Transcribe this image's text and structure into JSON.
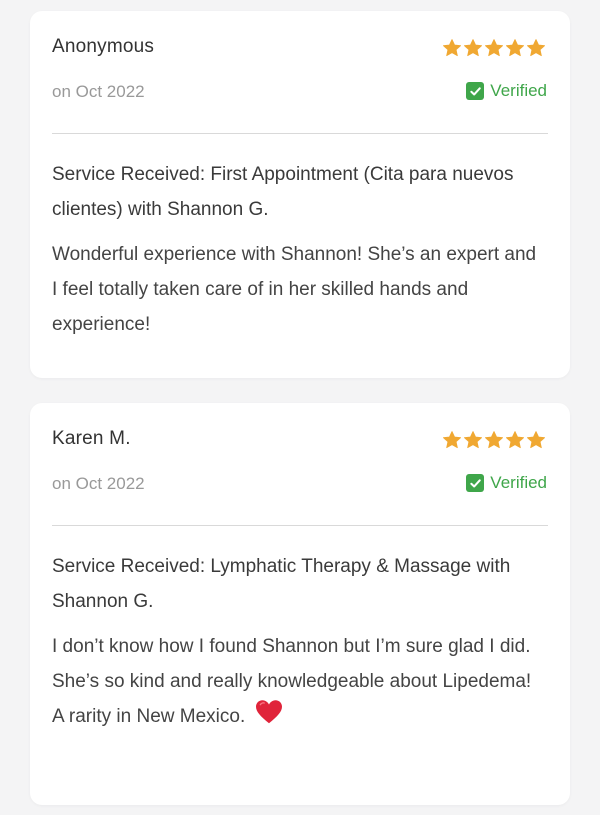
{
  "colors": {
    "page_background": "#f4f4f5",
    "card_background": "#ffffff",
    "star": "#f0a832",
    "verified": "#3fa64a",
    "date_text": "#999999",
    "heart": "#e0243a"
  },
  "reviews": [
    {
      "name": "Anonymous",
      "rating": 5,
      "date": "on Oct 2022",
      "verified_label": "Verified",
      "service": "Service Received: First Appointment (Cita para nuevos clientes) with Shannon G.",
      "text": "Wonderful experience with Shannon! She’s an expert and I feel totally taken care of in her skilled hands and experience!"
    },
    {
      "name": "Karen M.",
      "rating": 5,
      "date": "on Oct 2022",
      "verified_label": "Verified",
      "service": "Service Received: Lymphatic Therapy & Massage with Shannon G.",
      "text": "I don’t know how I found Shannon but I’m sure glad I did. She’s so kind and really knowledgeable about Lipedema! A rarity in New Mexico.",
      "emoji_icon": "red-heart-icon"
    }
  ]
}
